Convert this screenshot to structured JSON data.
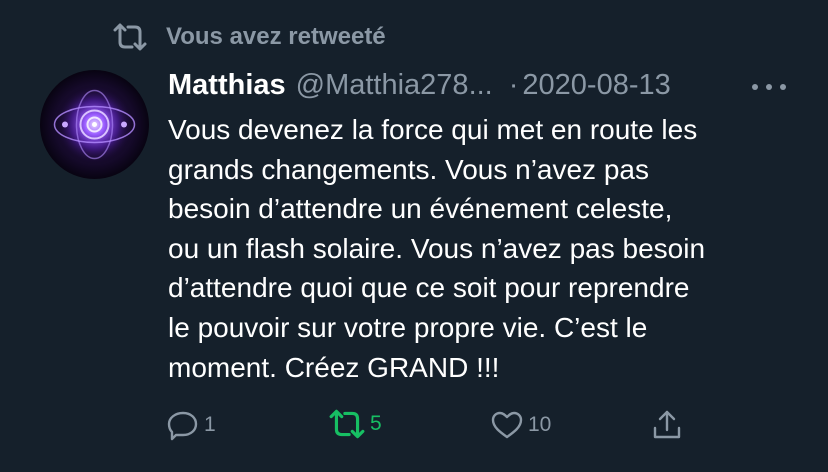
{
  "retweet_banner": {
    "text": "Vous avez retweeté"
  },
  "tweet": {
    "display_name": "Matthias",
    "handle": "@Matthia278...",
    "separator": "·",
    "date": "2020-08-13",
    "text": "Vous devenez la force qui met en route les\ngrands changements. Vous n’avez pas\nbesoin d’attendre un événement celeste,\nou un flash solaire. Vous n’avez pas besoin\nd’attendre quoi que ce soit pour reprendre\nle pouvoir sur votre propre vie. C’est le\nmoment. Créez GRAND !!!"
  },
  "actions": {
    "reply_count": "1",
    "retweet_count": "5",
    "like_count": "10"
  },
  "colors": {
    "background": "#15202b",
    "secondary_text": "#8b98a5",
    "retweet_active": "#17bf63"
  },
  "icons": [
    "retweet-icon",
    "more-icon",
    "reply-icon",
    "like-icon",
    "share-icon"
  ]
}
